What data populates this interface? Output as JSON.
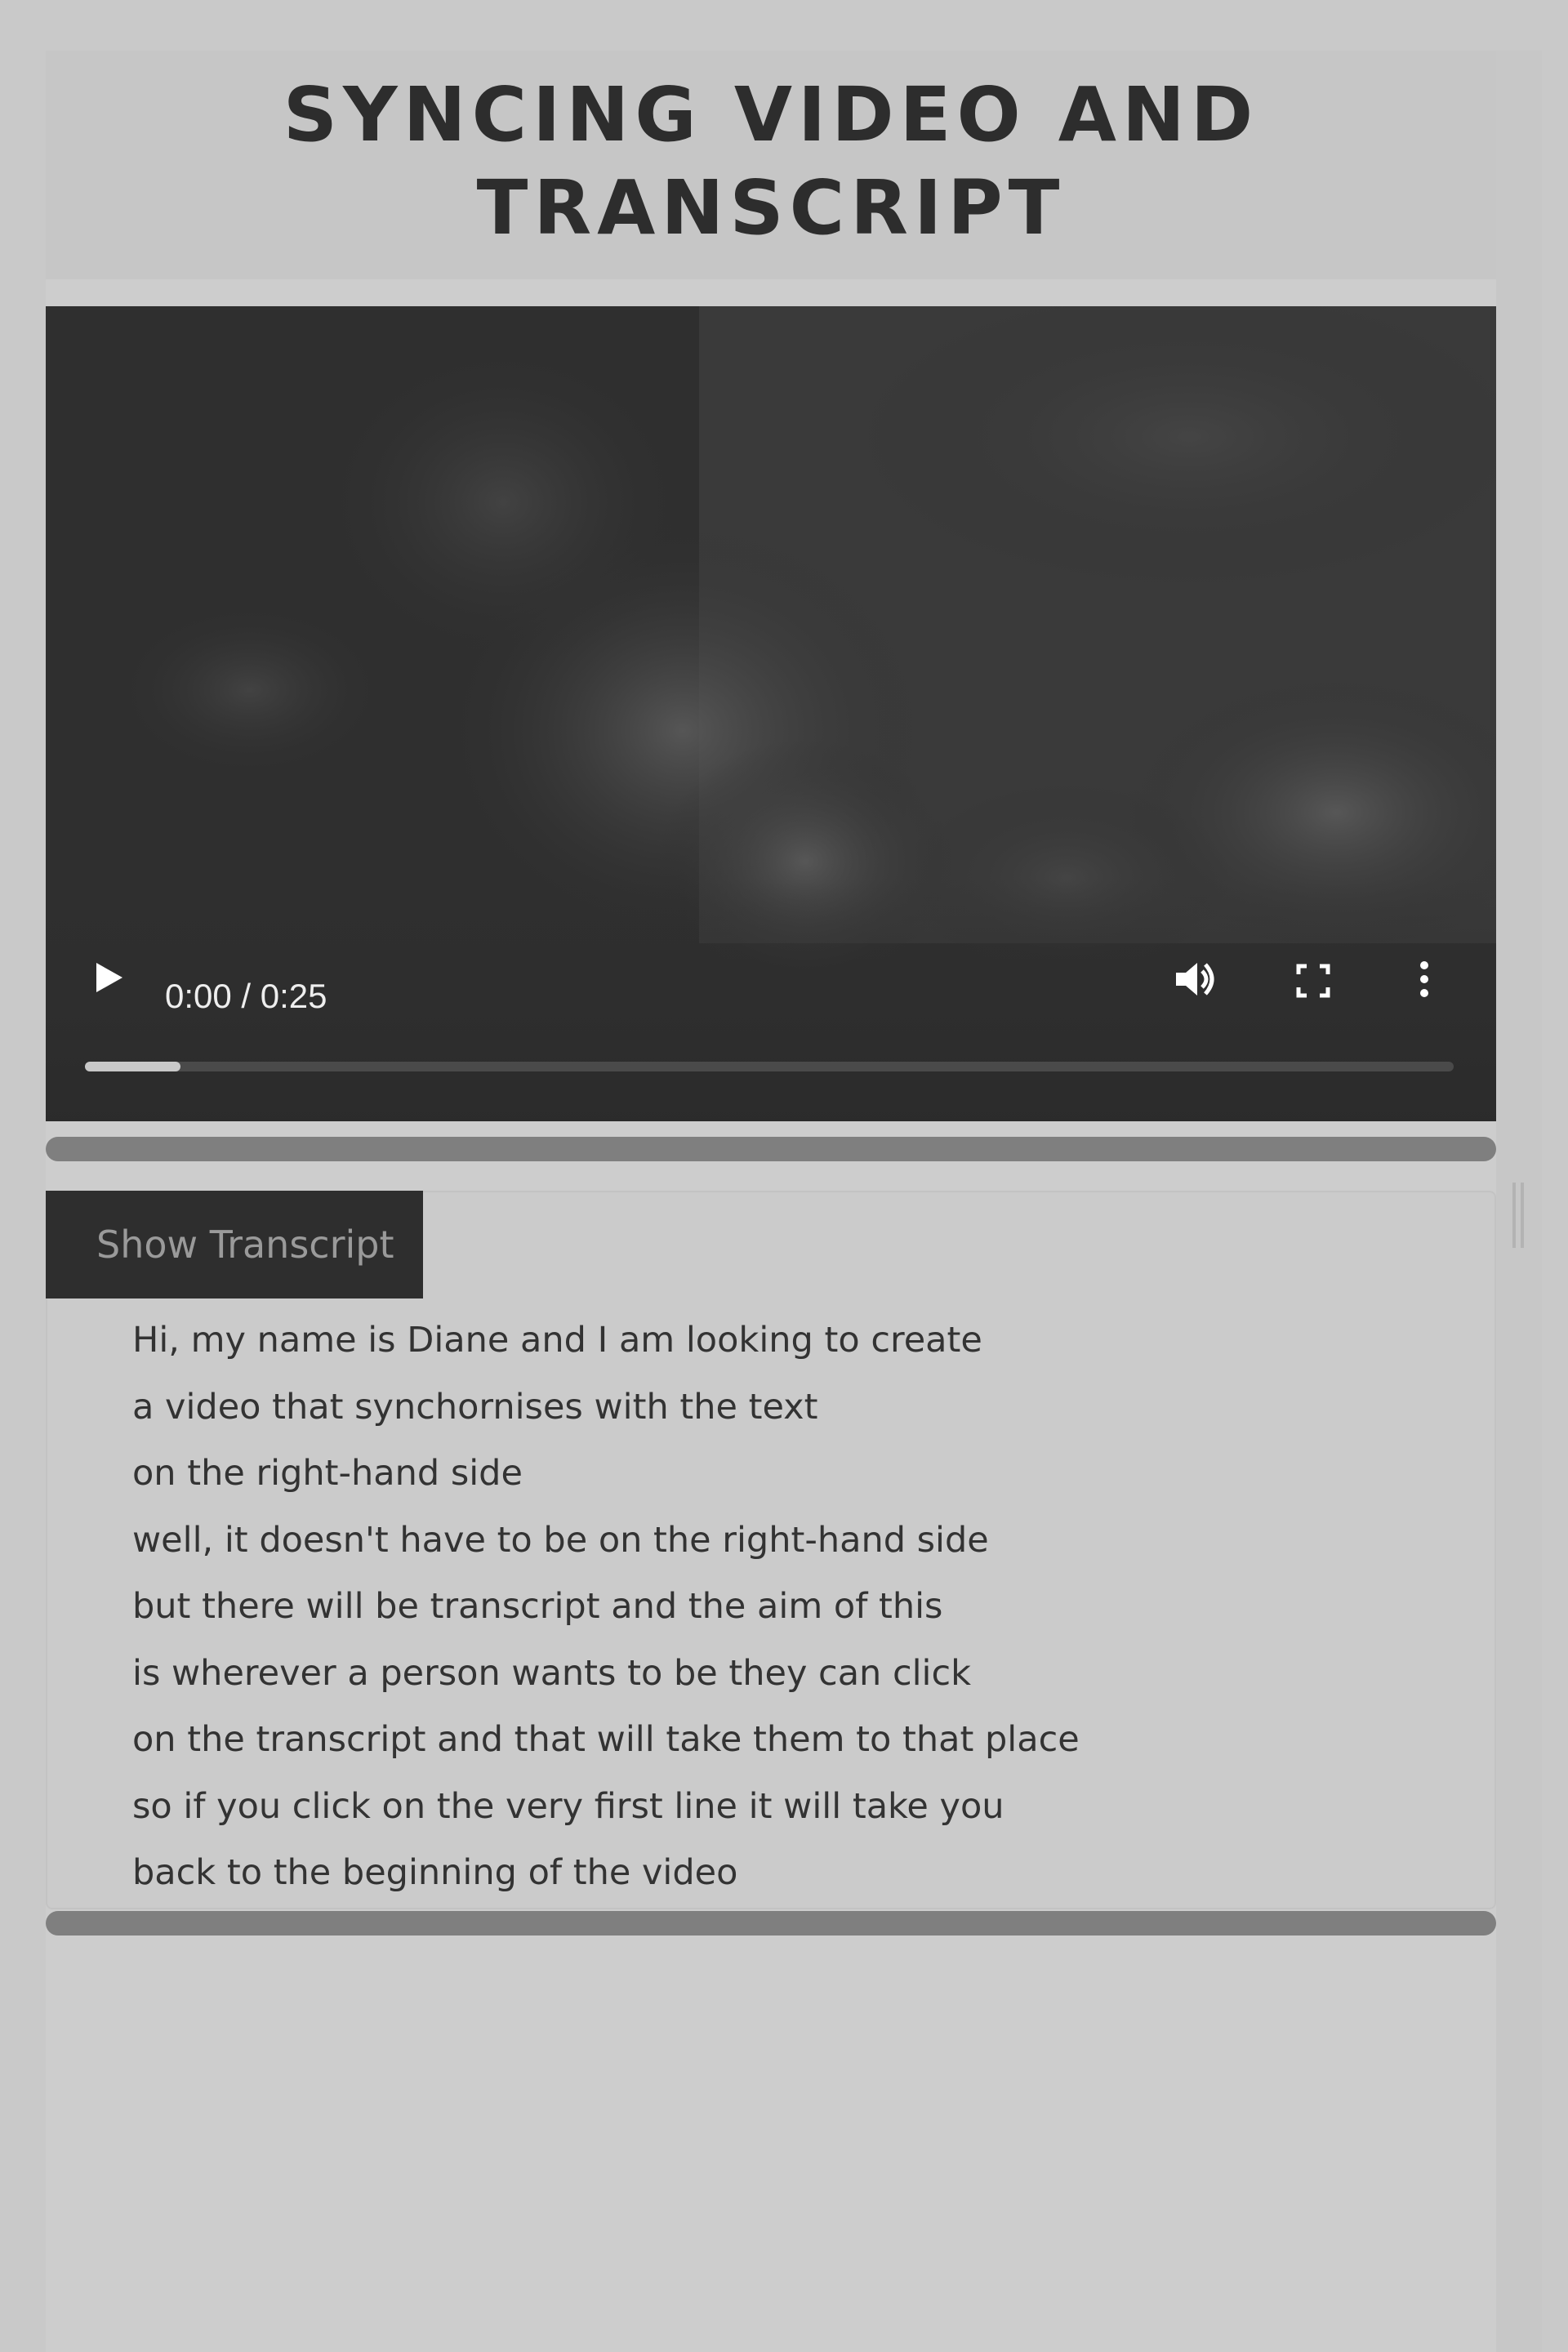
{
  "page": {
    "title": "SYNCING VIDEO AND TRANSCRIPT",
    "title_line1": "SYNCING VIDEO AND",
    "title_line2": "TRANSCRIPT"
  },
  "video": {
    "current_time": "0:00",
    "duration": "0:25",
    "time_display": "0:00 / 0:25",
    "buffered_fraction": 0.07,
    "icons": {
      "play": "play-icon",
      "volume": "volume-icon",
      "fullscreen": "fullscreen-icon",
      "more": "more-vertical-icon"
    }
  },
  "transcript": {
    "toggle_label": "Show Transcript",
    "lines": [
      "Hi, my name is Diane and I am looking to create",
      "a video that synchornises with the text",
      "on the right-hand side",
      "well, it doesn't have to be on the right-hand side",
      "but there will be transcript and the aim of this",
      "is wherever a person wants to be they can click",
      "on the transcript and that will take them to that place",
      "so if you click on the very first line it will take you",
      "back to the beginning of the video"
    ]
  },
  "colors": {
    "page_background": "#cdcdcd",
    "header_background": "#c6c6c6",
    "video_background": "#2e2e2e",
    "scrollbar": "#7f7f7f",
    "button_background": "#2e2e2e",
    "button_text": "#9a9a9a",
    "text": "#333333"
  }
}
